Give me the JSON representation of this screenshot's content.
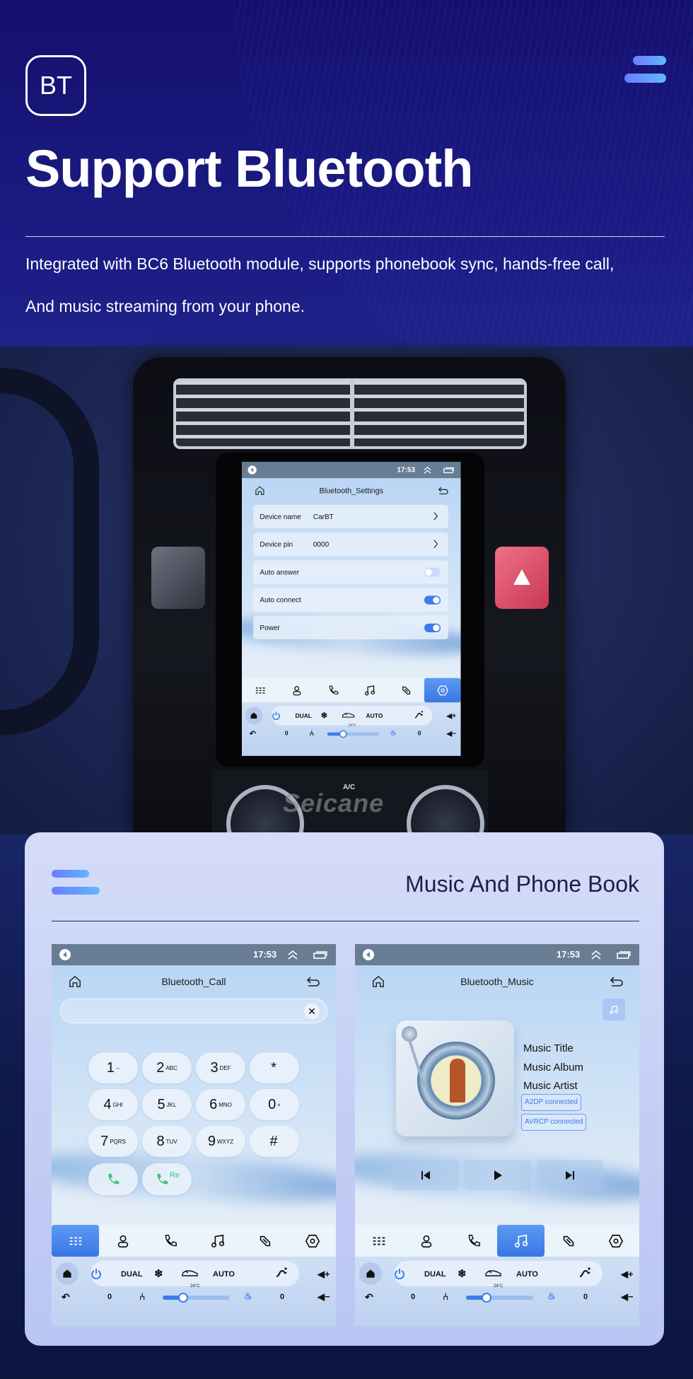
{
  "header": {
    "badge": "BT",
    "title": "Support Bluetooth",
    "desc_line1": "Integrated with BC6 Bluetooth module, supports phonebook sync, hands-free call,",
    "desc_line2": "And music streaming from your phone."
  },
  "car": {
    "watermark": "Seicane",
    "ac_label": "A/C"
  },
  "common": {
    "status_time": "17:53"
  },
  "climate": {
    "dual": "DUAL",
    "auto": "AUTO",
    "temp": "24°C",
    "left_value": "0",
    "right_value": "0",
    "fan_level": 0.3
  },
  "settings_screen": {
    "title": "Bluetooth_Settings",
    "rows": [
      {
        "label": "Device name",
        "value": "CarBT"
      },
      {
        "label": "Device pin",
        "value": "0000"
      }
    ],
    "toggles": [
      {
        "label": "Auto answer",
        "on": false
      },
      {
        "label": "Auto connect",
        "on": true
      },
      {
        "label": "Power",
        "on": true
      }
    ],
    "active_tab": "settings"
  },
  "section": {
    "title": "Music And Phone Book"
  },
  "call_screen": {
    "title": "Bluetooth_Call",
    "number_value": "",
    "keys": [
      {
        "digit": "1",
        "letters": "--"
      },
      {
        "digit": "2",
        "letters": "ABC"
      },
      {
        "digit": "3",
        "letters": "DEF"
      },
      {
        "digit": "*",
        "letters": ""
      },
      {
        "digit": "4",
        "letters": "GHI"
      },
      {
        "digit": "5",
        "letters": "JKL"
      },
      {
        "digit": "6",
        "letters": "MNO"
      },
      {
        "digit": "0",
        "letters": "+"
      },
      {
        "digit": "7",
        "letters": "PQRS"
      },
      {
        "digit": "8",
        "letters": "TUV"
      },
      {
        "digit": "9",
        "letters": "WXYZ"
      },
      {
        "digit": "#",
        "letters": ""
      }
    ],
    "redial_label": "Re",
    "active_tab": "keypad"
  },
  "music_screen": {
    "title": "Bluetooth_Music",
    "music_title": "Music Title",
    "music_album": "Music Album",
    "music_artist": "Music Artist",
    "a2dp": "A2DP  connected",
    "avrcp": "AVRCP connected",
    "active_tab": "music"
  },
  "nav_tabs": [
    "keypad-icon",
    "contacts-icon",
    "phone-icon",
    "music-note-icon",
    "link-icon",
    "settings-hexagon-icon"
  ],
  "colors": {
    "accent": "#3d7be8",
    "status_bar": "#687d94",
    "call_green": "#3cc47c",
    "hazard_red": "#e8506a",
    "page_navy": "#1c1d86"
  }
}
